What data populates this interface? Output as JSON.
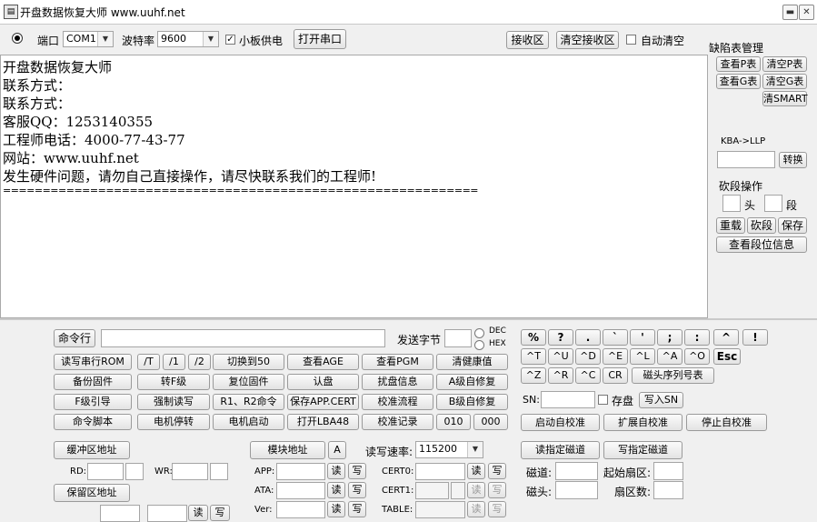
{
  "window": {
    "title": "开盘数据恢复大师 www.uuhf.net",
    "min_label": "▬",
    "close_label": "✕"
  },
  "serial": {
    "port_label": "端口",
    "port_value": "COM1",
    "baud_label": "波特率",
    "baud_value": "9600",
    "power_label": "小板供电",
    "power_checked": "✓",
    "open_button": "打开串口",
    "recv_button": "接收区",
    "clear_recv_button": "清空接收区",
    "auto_clear_label": "自动清空"
  },
  "receive": {
    "lines": [
      "开盘数据恢复大师",
      "联系方式：",
      "联系方式：",
      "客服QQ：1253140355",
      "工程师电话：4000-77-43-77",
      "网站：www.uuhf.net",
      "发生硬件问题，请勿自己直接操作，请尽快联系我们的工程师!",
      "============================================================"
    ]
  },
  "defect": {
    "title": "缺陷表管理",
    "view_p": "查看P表",
    "clear_p": "清空P表",
    "view_g": "查看G表",
    "clear_g": "清空G表",
    "clear_smart": "清SMART",
    "kba_label": "KBA->LLP",
    "convert": "转换",
    "cut_label": "砍段操作",
    "head_label": "头",
    "seg_label": "段",
    "rebuild": "重载",
    "cut": "砍段",
    "save": "保存",
    "view_seg": "查看段位信息"
  },
  "command": {
    "cmd_label": "命令行",
    "send_bytes_label": "发送字节",
    "dec": "DEC",
    "hex": "HEX",
    "row1": [
      "读写串行ROM",
      "/T",
      "/1",
      "/2",
      "切换到50",
      "查看AGE",
      "查看PGM",
      "清健康值"
    ],
    "row2": [
      "备份固件",
      "转F级",
      "复位固件",
      "认盘",
      "扰盘信息",
      "A级自修复"
    ],
    "row3": [
      "F级引导",
      "强制读写",
      "R1、R2命令",
      "保存APP.CERT",
      "校准流程",
      "B级自修复"
    ],
    "row4": [
      "命令脚本",
      "电机停转",
      "电机启动",
      "打开LBA48",
      "校准记录",
      "010",
      "000"
    ]
  },
  "keys": {
    "row1": [
      "%",
      "?",
      ".",
      "`",
      "'",
      ";",
      ":",
      "^",
      "!"
    ],
    "row2": [
      "^T",
      "^U",
      "^D",
      "^E",
      "^L",
      "^A",
      "^O",
      "Esc"
    ],
    "row3": [
      "^Z",
      "^R",
      "^C",
      "CR"
    ],
    "head_map": "磁头序列号表",
    "sn_label": "SN:",
    "save_label": "存盘",
    "write_sn": "写入SN",
    "start_cal": "启动自校准",
    "ext_cal": "扩展自校准",
    "stop_cal": "停止自校准"
  },
  "bottom": {
    "buffer_addr": "缓冲区地址",
    "rd_label": "RD:",
    "wr_label": "WR:",
    "reserve_addr": "保留区地址",
    "module_addr": "模块地址",
    "a_btn": "A",
    "speed_label": "读写速率:",
    "speed_value": "115200",
    "app_label": "APP:",
    "ata_label": "ATA:",
    "ver_label": "Ver:",
    "read": "读",
    "write": "写",
    "cert0_label": "CERT0:",
    "cert1_label": "CERT1:",
    "table_label": "TABLE:",
    "read_track": "读指定磁道",
    "write_track": "写指定磁道",
    "track_label": "磁道:",
    "start_sector_label": "起始扇区:",
    "head_label": "磁头:",
    "sector_count_label": "扇区数:"
  }
}
